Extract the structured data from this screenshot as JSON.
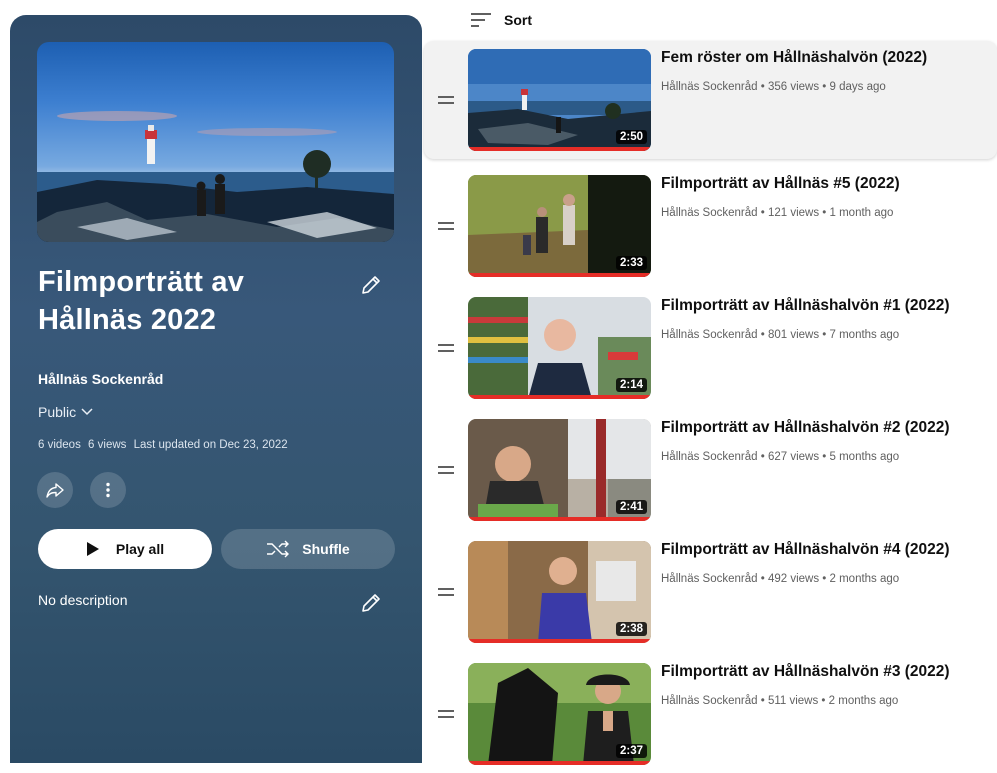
{
  "playlist": {
    "title": "Filmporträtt av Hållnäs 2022",
    "channel": "Hållnäs Sockenråd",
    "privacy": "Public",
    "video_count": "6 videos",
    "view_count": "6 views",
    "last_updated": "Last updated on Dec 23, 2022",
    "play_all_label": "Play all",
    "shuffle_label": "Shuffle",
    "description": "No description"
  },
  "list": {
    "sort_label": "Sort"
  },
  "videos": [
    {
      "title": "Fem röster om Hållnäshalvön (2022)",
      "meta": "Hållnäs Sockenråd • 356 views • 9 days ago",
      "duration": "2:50"
    },
    {
      "title": "Filmporträtt av Hållnäs #5 (2022)",
      "meta": "Hållnäs Sockenråd • 121 views • 1 month ago",
      "duration": "2:33"
    },
    {
      "title": "Filmporträtt av Hållnäshalvön #1 (2022)",
      "meta": "Hållnäs Sockenråd • 801 views • 7 months ago",
      "duration": "2:14"
    },
    {
      "title": "Filmporträtt av Hållnäshalvön #2 (2022)",
      "meta": "Hållnäs Sockenråd • 627 views • 5 months ago",
      "duration": "2:41"
    },
    {
      "title": "Filmporträtt av Hållnäshalvön #4 (2022)",
      "meta": "Hållnäs Sockenråd • 492 views • 2 months ago",
      "duration": "2:38"
    },
    {
      "title": "Filmporträtt av Hållnäshalvön #3 (2022)",
      "meta": "Hållnäs Sockenråd • 511 views • 2 months ago",
      "duration": "2:37"
    }
  ],
  "colors": {
    "panel": "#34557a",
    "progress": "#e52d27",
    "row_selected": "#f2f2f2"
  },
  "icons": [
    "pencil-icon",
    "chevron-down-icon",
    "share-icon",
    "more-vert-icon",
    "play-icon",
    "shuffle-icon",
    "sort-icon",
    "drag-handle-icon"
  ]
}
